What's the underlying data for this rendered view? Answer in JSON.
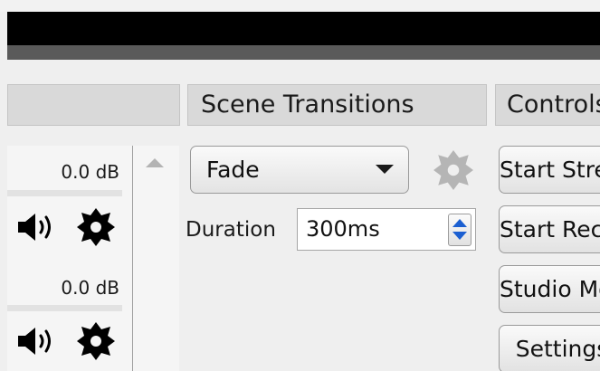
{
  "docks": {
    "mixer_title": "",
    "transitions_title": "Scene Transitions",
    "controls_title": "Controls"
  },
  "mixer": {
    "channels": [
      {
        "level": "0.0 dB",
        "speaker_icon": "speaker-icon",
        "settings_icon": "gear-icon"
      },
      {
        "level": "0.0 dB",
        "speaker_icon": "speaker-icon",
        "settings_icon": "gear-icon"
      }
    ]
  },
  "transitions": {
    "selected": "Fade",
    "duration_label": "Duration",
    "duration_value": "300ms"
  },
  "controls": {
    "buttons": [
      "Start Streaming",
      "Start Recording",
      "Studio Mode",
      "Settings"
    ]
  },
  "colors": {
    "titlebar": "#000000",
    "menubar": "#5a5a5a",
    "spinner_accent": "#1b5fd1",
    "disabled_gear": "#b5b5b5"
  }
}
